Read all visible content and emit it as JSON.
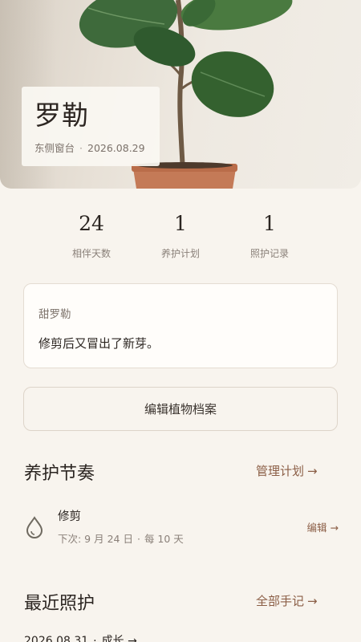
{
  "plant": {
    "name": "罗勒",
    "location": "东侧窗台",
    "date": "2026.08.29",
    "separator": "·"
  },
  "stats": [
    {
      "value": "24",
      "label": "相伴天数"
    },
    {
      "value": "1",
      "label": "养护计划"
    },
    {
      "value": "1",
      "label": "照护记录"
    }
  ],
  "note": {
    "author": "甜罗勒",
    "content": "修剪后又冒出了新芽。"
  },
  "edit_profile_label": "编辑植物档案",
  "care_section": {
    "title": "养护节奏",
    "link": "管理计划",
    "arrow": "→",
    "items": [
      {
        "name": "修剪",
        "next": "下次: 9 月 24 日",
        "separator": "·",
        "frequency": "每 10 天",
        "edit": "编辑",
        "arrow": "→",
        "icon": "water-drop-icon"
      }
    ]
  },
  "recent_section": {
    "title": "最近照护",
    "link": "全部手记",
    "arrow": "→",
    "items": [
      {
        "date": "2026.08.31",
        "separator": "·",
        "label": "成长",
        "arrow": "→"
      }
    ]
  },
  "colors": {
    "background": "#f8f4ee",
    "accent": "#8b5e46",
    "text": "#2b2521",
    "muted": "#8a8079",
    "card": "#fffdfa"
  }
}
